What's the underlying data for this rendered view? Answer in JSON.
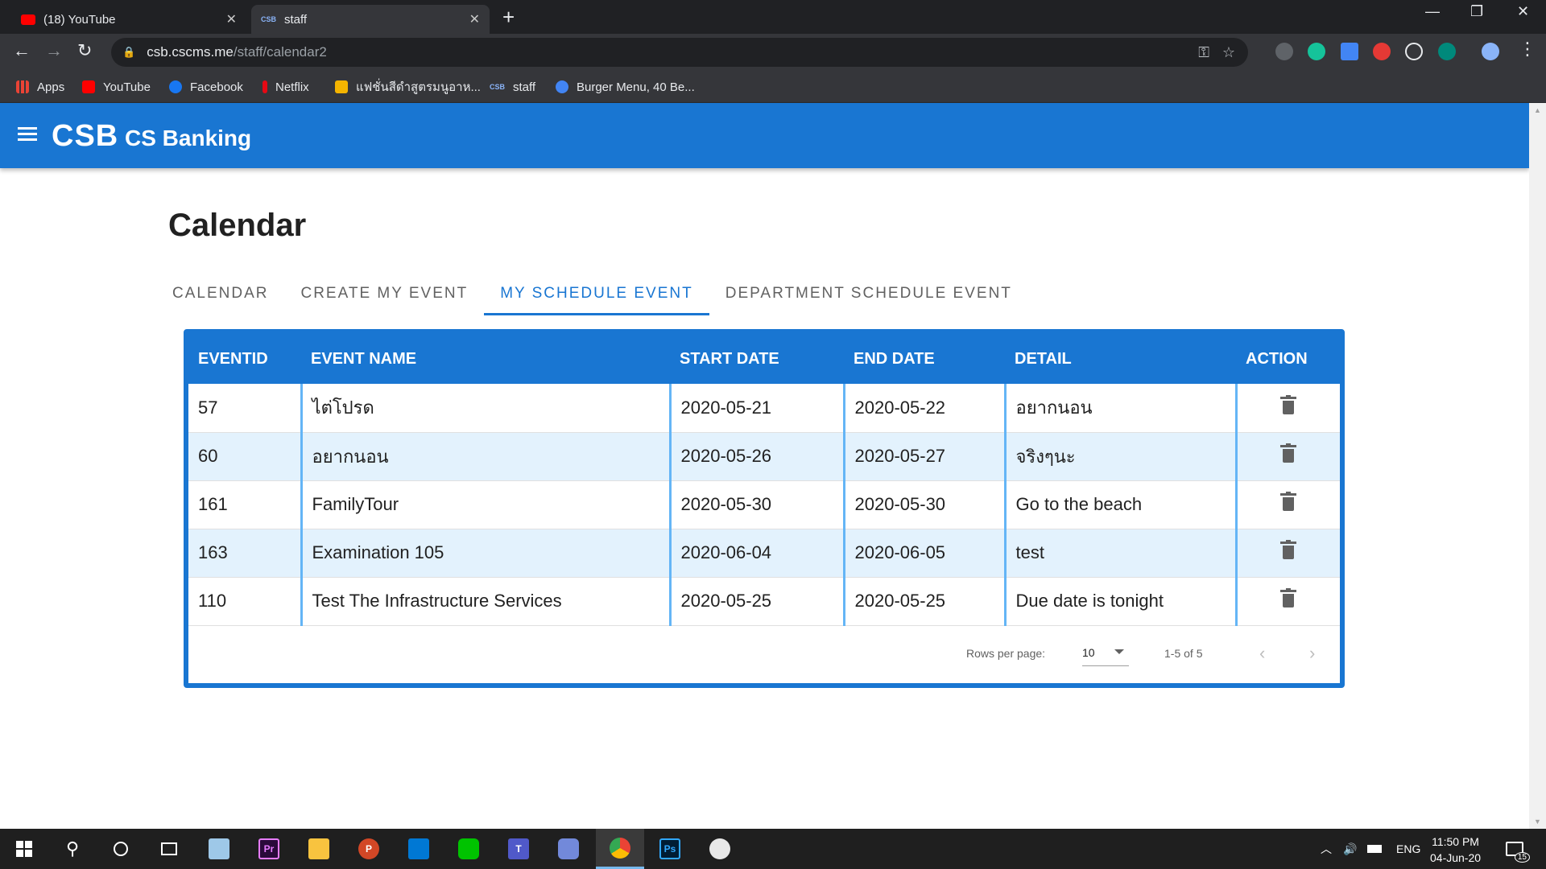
{
  "browser": {
    "tabs": [
      {
        "title": "(18) YouTube",
        "active": false
      },
      {
        "title": "staff",
        "active": true,
        "favicon_text": "CSB"
      }
    ],
    "url_host": "csb.cscms.me",
    "url_path": "/staff/calendar2",
    "bookmarks": [
      {
        "label": "Apps",
        "icon": "apps-grid-icon",
        "color": "#ea4335"
      },
      {
        "label": "YouTube",
        "icon": "youtube-icon",
        "color": "#ff0000"
      },
      {
        "label": "Facebook",
        "icon": "facebook-icon",
        "color": "#1877f2"
      },
      {
        "label": "Netflix",
        "icon": "netflix-icon",
        "color": "#e50914"
      },
      {
        "label": "แฟชั่นสีดำสูตรมนูอาห...",
        "icon": "bookmark-p-icon",
        "color": "#f4b400"
      },
      {
        "label": "staff",
        "icon": "csb-icon",
        "color": "#8ab4f8",
        "favicon_text": "CSB"
      },
      {
        "label": "Burger Menu, 40 Be...",
        "icon": "burger-site-icon",
        "color": "#4285f4"
      }
    ]
  },
  "app": {
    "logo": "CSB",
    "name": "CS Banking",
    "brand_color": "#1976d2"
  },
  "page": {
    "title": "Calendar",
    "tabs": [
      {
        "label": "CALENDAR",
        "active": false
      },
      {
        "label": "CREATE MY EVENT",
        "active": false
      },
      {
        "label": "MY SCHEDULE EVENT",
        "active": true
      },
      {
        "label": "DEPARTMENT SCHEDULE EVENT",
        "active": false
      }
    ]
  },
  "table": {
    "columns": [
      "EVENTID",
      "EVENT NAME",
      "START DATE",
      "END DATE",
      "DETAIL",
      "ACTION"
    ],
    "rows": [
      {
        "id": "57",
        "name": "ไต่โปรด",
        "start": "2020-05-21",
        "end": "2020-05-22",
        "detail": "อยากนอน"
      },
      {
        "id": "60",
        "name": "อยากนอน",
        "start": "2020-05-26",
        "end": "2020-05-27",
        "detail": "จริงๆนะ"
      },
      {
        "id": "161",
        "name": "FamilyTour",
        "start": "2020-05-30",
        "end": "2020-05-30",
        "detail": "Go to the beach"
      },
      {
        "id": "163",
        "name": "Examination 105",
        "start": "2020-06-04",
        "end": "2020-06-05",
        "detail": "test"
      },
      {
        "id": "110",
        "name": "Test The Infrastructure Services",
        "start": "2020-05-25",
        "end": "2020-05-25",
        "detail": "Due date is tonight"
      }
    ],
    "pagination": {
      "rows_per_page_label": "Rows per page:",
      "rows_per_page": "10",
      "range": "1-5 of 5"
    }
  },
  "taskbar": {
    "language": "ENG",
    "time": "11:50 PM",
    "date": "04-Jun-20",
    "notifications": "15"
  }
}
